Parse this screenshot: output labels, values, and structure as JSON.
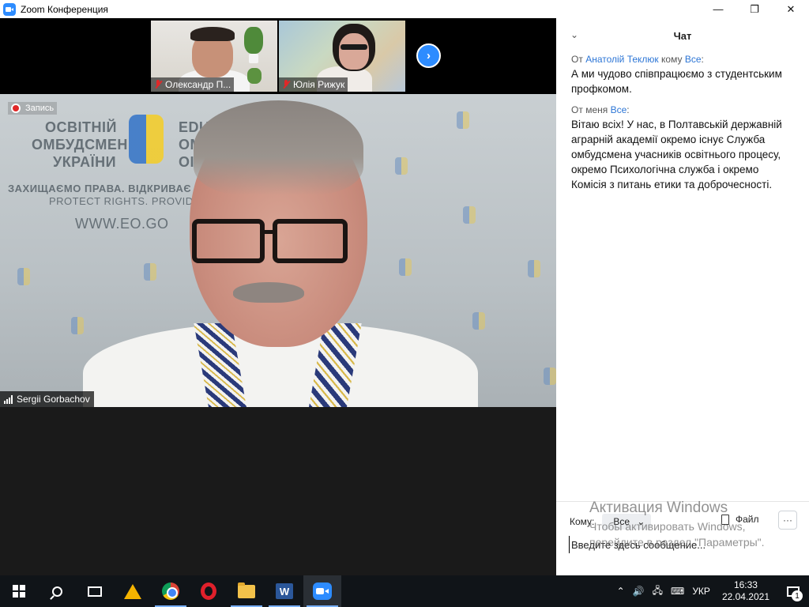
{
  "window": {
    "title": "Zoom Конференция",
    "icons": {
      "app": "zoom-app-icon",
      "minimize": "minimize-icon",
      "maximize": "restore-icon",
      "close": "close-icon"
    },
    "controls": {
      "minimize": "—",
      "restore": "❐",
      "close": "✕"
    }
  },
  "participants": [
    {
      "name": "Олександр П...",
      "muted": true
    },
    {
      "name": "Юлія Рижук",
      "muted": true
    }
  ],
  "next_participants_icon": "chevron-right-icon",
  "next_glyph": "›",
  "main_video": {
    "recording_label": "Запись",
    "speaker_name": "Sergii Gorbachov",
    "banner": {
      "line1": "ОСВІТНІЙ",
      "line2": "ОМБУДСМЕН",
      "line3": "УКРАЇНИ",
      "right1": "EDU",
      "right2": "OM",
      "right3": "OI",
      "slogan": "ЗАХИЩАЄМО ПРАВА. ВІДКРИВАЄ",
      "slogan_en": "PROTECT RIGHTS. PROVID",
      "site": "WWW.EO.GO"
    }
  },
  "chat": {
    "title": "Чат",
    "collapse_glyph": "⌄",
    "messages": [
      {
        "from_prefix": "От",
        "sender": "Анатолій Теклюк",
        "to_prefix": "кому",
        "recipient": "Все",
        "suffix": ":",
        "text": "А ми чудово співпрацюємо з студентським профкомом."
      },
      {
        "from_prefix": "От",
        "sender": "меня",
        "recipient": "Все",
        "suffix": ":",
        "text": "Вітаю всіх! У нас, в Полтавській державній аграрній академії окремо існує Служба омбудсмена учасників освітнього процесу, окремо Психологічна служба і окремо Комісія з питань етики та доброчесності."
      }
    ],
    "to_label": "Кому:",
    "to_value": "Все",
    "to_chevron": "⌄",
    "file_label": "Файл",
    "more_label": "···",
    "input_placeholder": "Введите здесь сообщение..."
  },
  "watermark": {
    "line1": "Активация Windows",
    "line2": "Чтобы активировать Windows,",
    "line3": "перейдите в раздел \"Параметры\"."
  },
  "taskbar": {
    "icons": [
      "windows-start-icon",
      "search-icon",
      "task-view-icon",
      "warning-app-icon",
      "chrome-icon",
      "opera-icon",
      "file-explorer-icon",
      "word-icon",
      "zoom-icon"
    ],
    "tray": {
      "chevron": "⌃",
      "volume": "🔊",
      "network": "🖧",
      "keyboard": "⌨",
      "language": "УКР",
      "time": "16:33",
      "date": "22.04.2021",
      "notification_count": "1"
    }
  },
  "colors": {
    "zoom_blue": "#2d8cff",
    "link_blue": "#2d76d6",
    "muted_red": "#e02828",
    "taskbar": "#101418"
  }
}
